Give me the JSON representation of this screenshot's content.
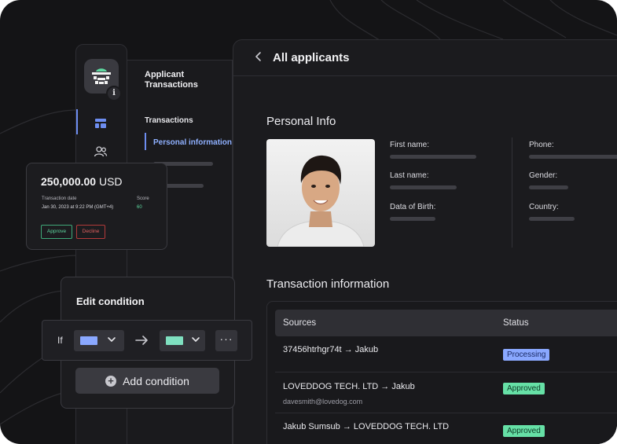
{
  "header": {
    "back_icon": "chevron-left-icon",
    "title": "All applicants"
  },
  "sidebar": {
    "icons": [
      "app-logo-icon",
      "info-icon",
      "layout-icon",
      "users-icon"
    ],
    "info_label": "i"
  },
  "subnav": {
    "title": "Applicant Transactions",
    "items": [
      {
        "label": "Transactions",
        "active": false
      },
      {
        "label": "Personal information",
        "active": true
      }
    ]
  },
  "personal_info": {
    "title": "Personal Info",
    "fields_left": [
      "First name:",
      "Last name:",
      "Data of Birth:"
    ],
    "fields_right": [
      "Phone:",
      "Gender:",
      "Country:"
    ]
  },
  "transactions": {
    "title": "Transaction information",
    "columns": [
      "Sources",
      "Status"
    ],
    "rows": [
      {
        "from": "37456htrhgr74t",
        "to": "Jakub",
        "sub": "",
        "status": "Processing",
        "status_type": "processing"
      },
      {
        "from": "LOVEDDOG TECH. LTD",
        "to": "Jakub",
        "sub": "davesmith@lovedog.com",
        "status": "Approved",
        "status_type": "approved"
      },
      {
        "from": "Jakub Sumsub",
        "to": "LOVEDDOG TECH. LTD",
        "sub": "",
        "status": "Approved",
        "status_type": "approved"
      }
    ],
    "arrow_glyph": "→"
  },
  "tx_card": {
    "amount": "250,000.00",
    "currency": "USD",
    "date_label": "Transaction date",
    "date_value": "Jan 30, 2023 at 9:22 PM (GMT+4)",
    "score_label": "Score",
    "score_value": "60",
    "approve_label": "Approve",
    "decline_label": "Decline"
  },
  "condition": {
    "title": "Edit condition",
    "if_label": "If",
    "more_label": "···",
    "add_label": "Add condition",
    "add_glyph": "+",
    "swatch_a": "#8aa8ff",
    "swatch_b": "#7fe0c0"
  },
  "colors": {
    "accent": "#6d8df0",
    "approved": "#66e0a6",
    "processing": "#8aa8ff"
  }
}
